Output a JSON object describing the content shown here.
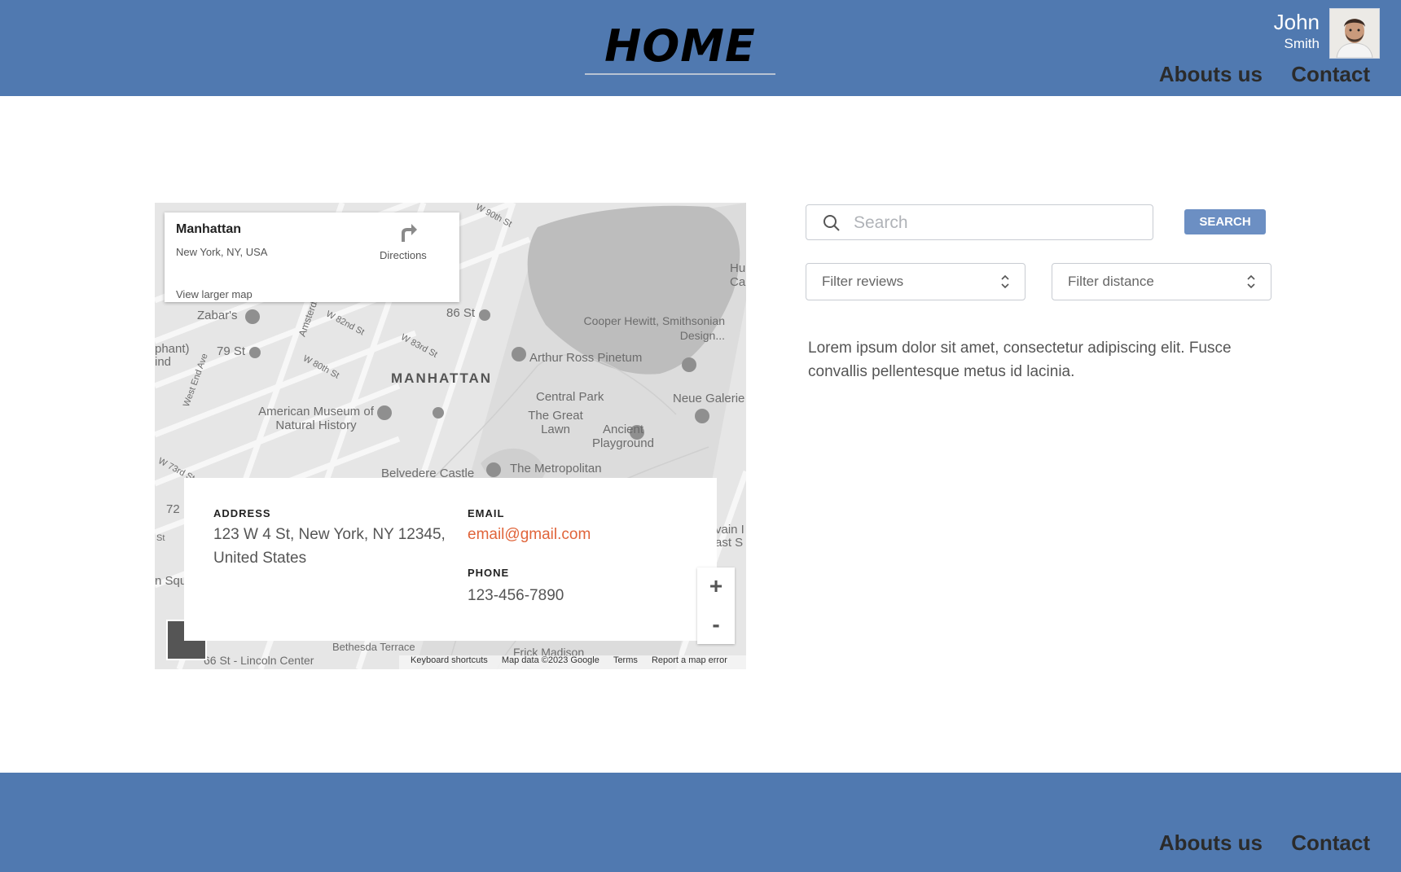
{
  "header": {
    "title": "HOME",
    "user": {
      "first_name": "John",
      "last_name": "Smith"
    },
    "nav": [
      "Abouts us",
      "Contact"
    ]
  },
  "map": {
    "place": {
      "name": "Manhattan",
      "subtitle": "New York, NY, USA",
      "larger_map_link": "View larger map",
      "directions_label": "Directions"
    },
    "labels": [
      "86 St",
      "Zabar's",
      "79 St",
      "MANHATTAN",
      "Arthur Ross Pinetum",
      "Cooper Hewitt, Smithsonian Design...",
      "Central Park",
      "The Great Lawn",
      "Ancient Playground",
      "American Museum of Natural History",
      "Neue Galerie",
      "The Metropolitan",
      "Belvedere Castle",
      "W 82nd St",
      "W 83rd St",
      "W 80th St",
      "Amsterdam",
      "West End Ave",
      "W 90th St",
      "W 73rd St",
      "Hu Cam",
      "phant) ind",
      "72",
      "St",
      "n Squ",
      "vain I ast S",
      "66 St - Lincoln Center",
      "Bethesda Terrace",
      "Frick Madison"
    ],
    "footer": {
      "shortcuts": "Keyboard shortcuts",
      "data": "Map data ©2023 Google",
      "terms": "Terms",
      "report": "Report a map error"
    },
    "zoom_in": "+",
    "zoom_out": "-"
  },
  "contact": {
    "address_label": "ADDRESS",
    "address_line1": "123 W 4 St, New York, NY 12345,",
    "address_line2": "United States",
    "email_label": "EMAIL",
    "email": "email@gmail.com",
    "phone_label": "PHONE",
    "phone": "123-456-7890"
  },
  "search": {
    "placeholder": "Search",
    "button_label": "SEARCH"
  },
  "filters": {
    "reviews": "Filter reviews",
    "distance": "Filter distance"
  },
  "description": "Lorem ipsum dolor sit amet, consectetur adipiscing elit. Fusce convallis pellentesque metus id lacinia.",
  "footer": {
    "nav": [
      "Abouts us",
      "Contact"
    ]
  },
  "colors": {
    "header_bg": "#5079b0",
    "button_bg": "#6c8fc3",
    "email": "#e0643a"
  },
  "icons": [
    "search-icon",
    "chevron-updown-icon",
    "directions-icon",
    "avatar"
  ]
}
